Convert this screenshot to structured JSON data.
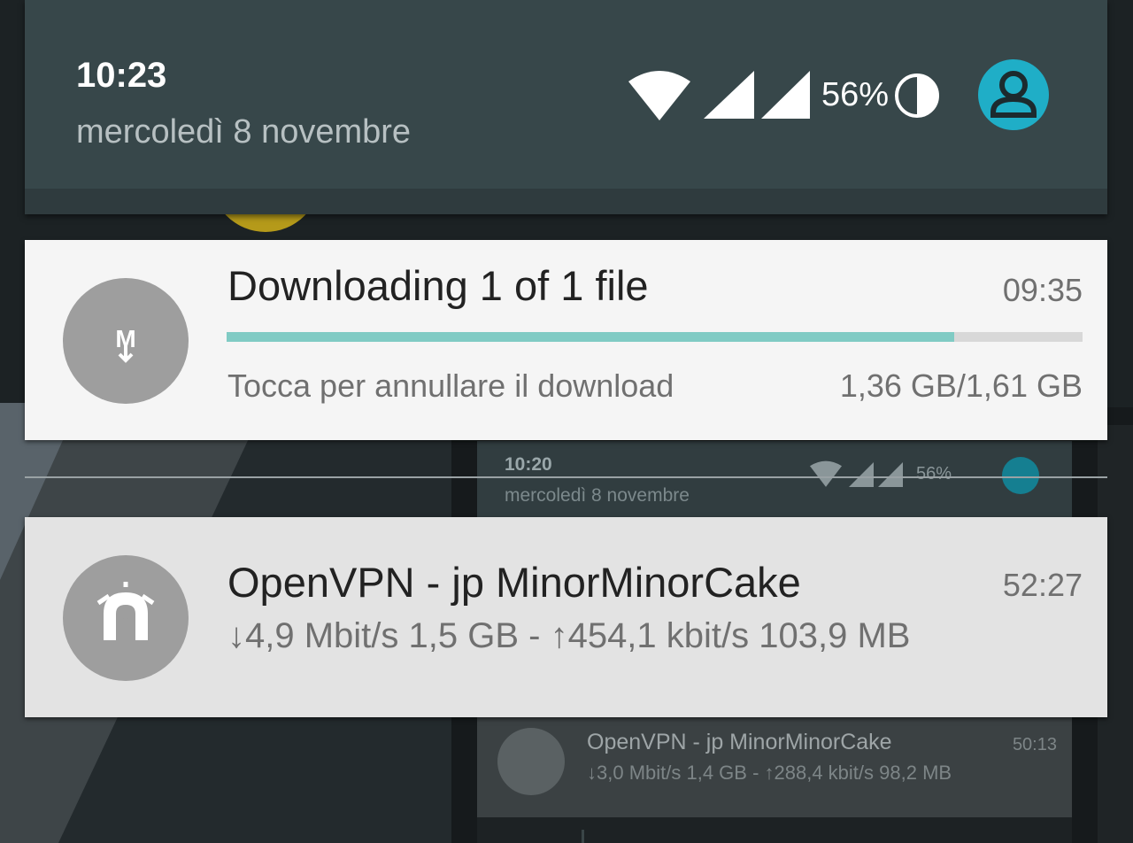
{
  "status_bar": {
    "time": "10:23",
    "date": "mercoledì 8 novembre",
    "battery_percent": "56%",
    "icons": [
      "wifi-icon",
      "cell-signal-icon",
      "cell-signal-icon",
      "battery-icon",
      "user-avatar-icon"
    ],
    "avatar_color": "#1faec7"
  },
  "notifications": [
    {
      "app_icon": "download-manager-icon",
      "title": "Downloading 1 of 1 file",
      "time": "09:35",
      "progress_fraction": 0.85,
      "text": "Tocca per annullare il download",
      "info": "1,36 GB/1,61 GB",
      "accent": "#80cbc4"
    },
    {
      "app_icon": "openvpn-lock-icon",
      "title": "OpenVPN - jp MinorMinorCake",
      "time": "52:27",
      "stats": "↓4,9 Mbit/s 1,5 GB - ↑454,1 kbit/s 103,9 MB"
    }
  ],
  "background_preview": {
    "time": "10:20",
    "date": "mercoledì 8 novembre",
    "battery_percent": "56%",
    "notification": {
      "title": "OpenVPN - jp MinorMinorCake",
      "time": "50:13",
      "stats": "↓3,0 Mbit/s 1,4 GB - ↑288,4 kbit/s 98,2 MB"
    }
  }
}
